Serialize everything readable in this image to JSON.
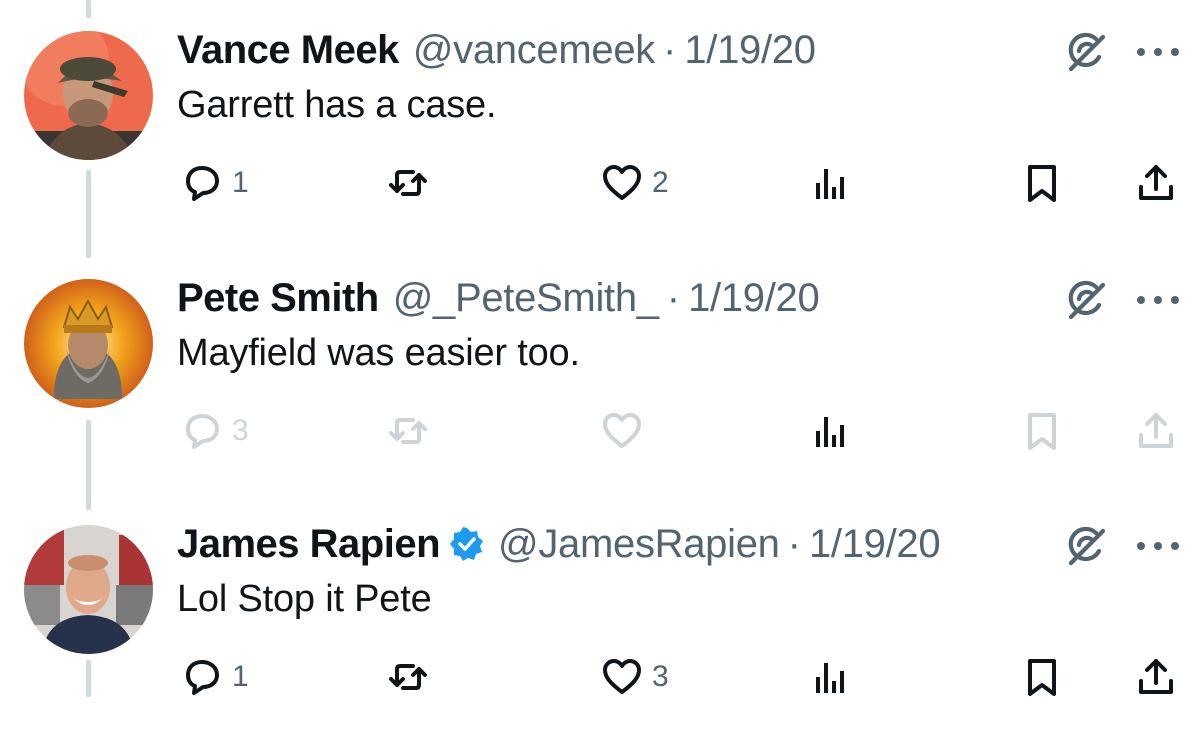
{
  "colors": {
    "text": "#0f1419",
    "secondary": "#536471",
    "verified": "#1d9bf0",
    "thread_line": "#cfd9de"
  },
  "tweets": [
    {
      "name": "Vance Meek",
      "handle": "@vancemeek",
      "separator": "·",
      "date": "1/19/20",
      "verified": false,
      "text": "Garrett has a case.",
      "replies": "1",
      "retweets": "",
      "likes": "2",
      "actions_dimmed": false
    },
    {
      "name": "Pete Smith",
      "handle": "@_PeteSmith_",
      "separator": "·",
      "date": "1/19/20",
      "verified": false,
      "text": "Mayfield was easier too.",
      "replies": "3",
      "retweets": "",
      "likes": "",
      "actions_dimmed": true
    },
    {
      "name": "James Rapien",
      "handle": "@JamesRapien",
      "separator": "·",
      "date": "1/19/20",
      "verified": true,
      "text": "Lol Stop it Pete",
      "replies": "1",
      "retweets": "",
      "likes": "3",
      "actions_dimmed": false
    }
  ],
  "icons": [
    "reply-icon",
    "retweet-icon",
    "like-icon",
    "analytics-icon",
    "bookmark-icon",
    "share-icon",
    "grok-icon",
    "more-icon",
    "verified-icon"
  ]
}
